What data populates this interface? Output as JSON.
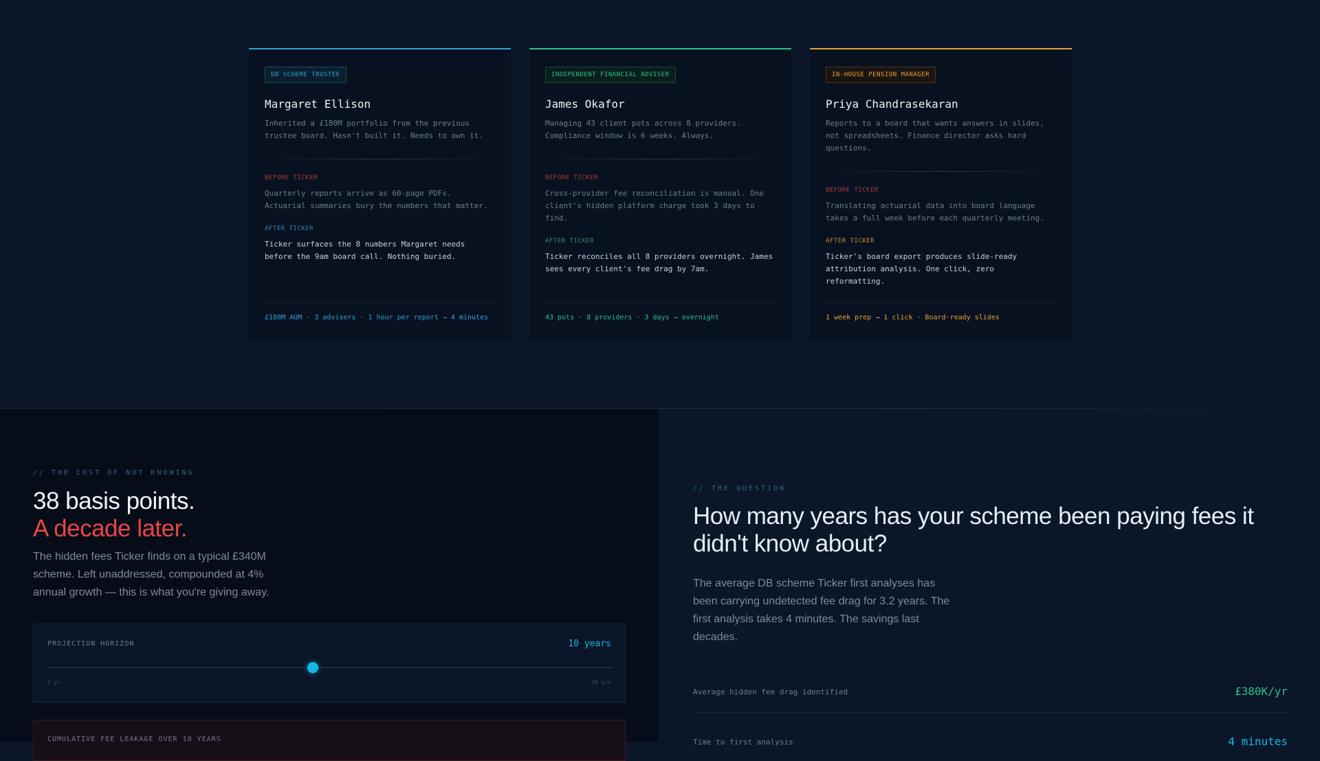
{
  "cards": [
    {
      "badge": "DB SCHEME TRUSTEE",
      "name": "Margaret Ellison",
      "desc": "Inherited a £180M portfolio from the previous trustee board. Hasn't built it. Needs to own it.",
      "before_label": "BEFORE TICKER",
      "before_text": "Quarterly reports arrive as 60-page PDFs. Actuarial summaries bury the numbers that matter.",
      "after_label": "AFTER TICKER",
      "after_text": "Ticker surfaces the 8 numbers Margaret needs before the 9am board call. Nothing buried.",
      "footer": "£180M AUM · 3 advisers · 1 hour per report → 4 minutes",
      "color": "#2aa3d6"
    },
    {
      "badge": "INDEPENDENT FINANCIAL ADVISER",
      "name": "James Okafor",
      "desc": "Managing 43 client pots across 8 providers. Compliance window is 6 weeks. Always.",
      "before_label": "BEFORE TICKER",
      "before_text": "Cross-provider fee reconciliation is manual. One client's hidden platform charge took 3 days to find.",
      "after_label": "AFTER TICKER",
      "after_text": "Ticker reconciles all 8 providers overnight. James sees every client's fee drag by 7am.",
      "footer": "43 pots · 8 providers · 3 days → overnight",
      "color": "#2fbf8a"
    },
    {
      "badge": "IN-HOUSE PENSION MANAGER",
      "name": "Priya Chandrasekaran",
      "desc": "Reports to a board that wants answers in slides, not spreadsheets. Finance director asks hard questions.",
      "before_label": "BEFORE TICKER",
      "before_text": "Translating actuarial data into board language takes a full week before each quarterly meeting.",
      "after_label": "AFTER TICKER",
      "after_text": "Ticker's board export produces slide-ready attribution analysis. One click, zero reformatting.",
      "footer": "1 week prep → 1 click · Board-ready slides",
      "color": "#e8a13a"
    }
  ],
  "cost": {
    "kicker": "// THE COST OF NOT KNOWING",
    "title_line1": "38 basis points.",
    "title_line2": "A decade later.",
    "body": "The hidden fees Ticker finds on a typical £340M scheme. Left unaddressed, compounded at 4% annual growth — this is what you're giving away.",
    "slider_label": "PROJECTION HORIZON",
    "slider_value": "10 years",
    "slider_min": "1 yr",
    "slider_max": "20 yrs",
    "slider_level": 0.47,
    "leak_label": "CUMULATIVE FEE LEAKAGE OVER 10 YEARS"
  },
  "question": {
    "kicker": "// THE QUESTION",
    "title": "How many years has your scheme been paying fees it didn't know about?",
    "body": "The average DB scheme Ticker first analyses has been carrying undetected fee drag for 3.2 years. The first analysis takes 4 minutes. The savings last decades.",
    "stats": [
      {
        "label": "Average hidden fee drag identified",
        "value": "£380K/yr",
        "color": "#2fbf8a"
      },
      {
        "label": "Time to first analysis",
        "value": "4 minutes",
        "color": "#16b7e6"
      }
    ]
  },
  "colors": {
    "red": "#e84545",
    "cyan": "#16b7e6"
  }
}
